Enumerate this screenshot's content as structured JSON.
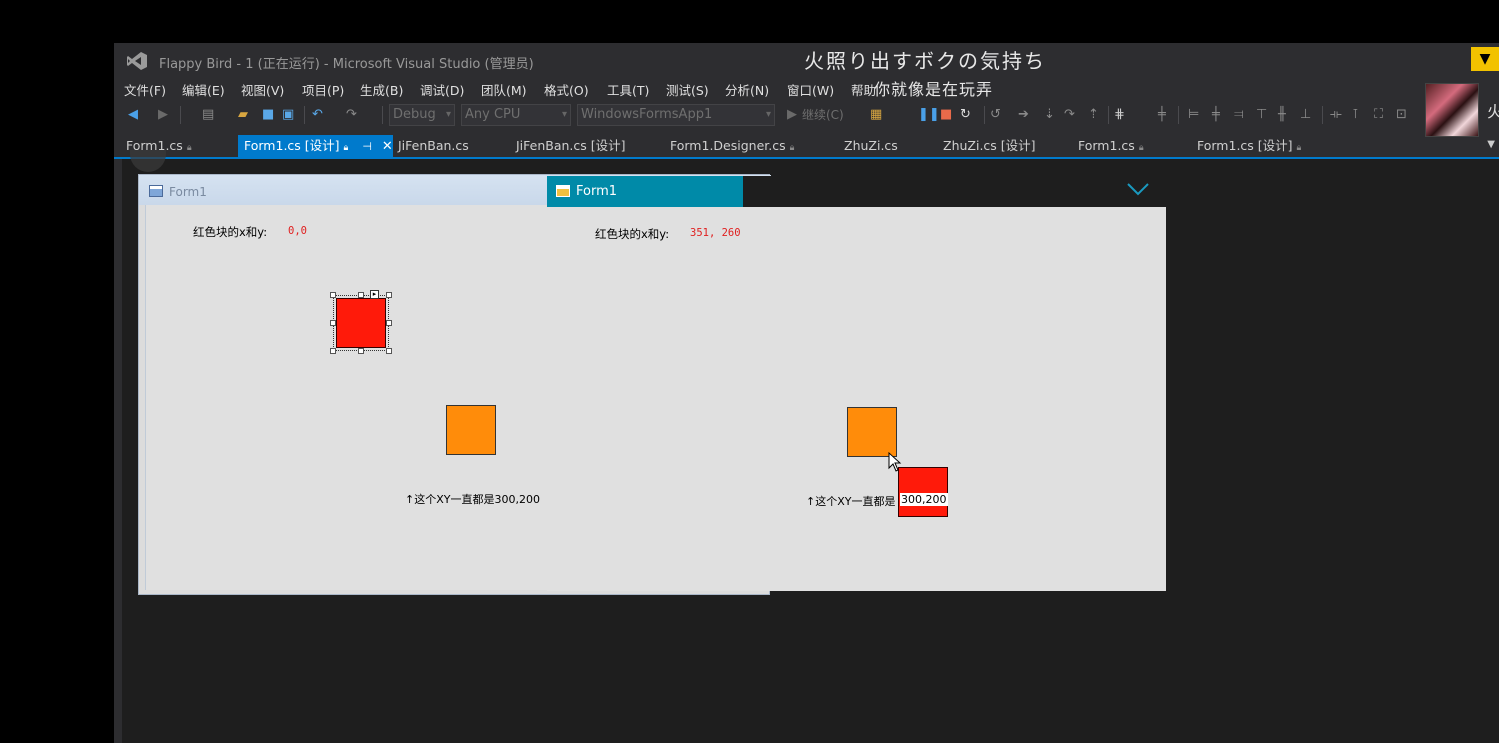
{
  "window": {
    "title": "Flappy Bird - 1 (正在运行) - Microsoft Visual Studio (管理员)"
  },
  "lyrics": {
    "line1": "火照り出すボクの気持ち",
    "line2": "你就像是在玩弄"
  },
  "edge_text": "火",
  "menu": [
    "文件(F)",
    "编辑(E)",
    "视图(V)",
    "项目(P)",
    "生成(B)",
    "调试(D)",
    "团队(M)",
    "格式(O)",
    "工具(T)",
    "测试(S)",
    "分析(N)",
    "窗口(W)",
    "帮助"
  ],
  "toolbar": {
    "config": "Debug",
    "platform": "Any CPU",
    "project": "WindowsFormsApp1",
    "continue_label": "继续(C)"
  },
  "tabs": [
    {
      "label": "Form1.cs",
      "pinned": true,
      "active": false
    },
    {
      "label": "Form1.cs [设计]",
      "pinned": true,
      "active": true
    },
    {
      "label": "JiFenBan.cs",
      "pinned": false,
      "active": false
    },
    {
      "label": "JiFenBan.cs [设计]",
      "pinned": false,
      "active": false
    },
    {
      "label": "Form1.Designer.cs",
      "pinned": true,
      "active": false
    },
    {
      "label": "ZhuZi.cs",
      "pinned": false,
      "active": false
    },
    {
      "label": "ZhuZi.cs [设计]",
      "pinned": false,
      "active": false
    },
    {
      "label": "Form1.cs",
      "pinned": true,
      "active": false
    },
    {
      "label": "Form1.cs [设计]",
      "pinned": true,
      "active": false
    }
  ],
  "designer_form": {
    "title": "Form1",
    "coord_label": "红色块的x和y:",
    "coord_value": "0,0",
    "note": "↑这个XY一直都是300,200"
  },
  "running_form": {
    "title": "Form1",
    "coord_label": "红色块的x和y:",
    "coord_value": "351, 260",
    "note": "↑这个XY一直都是",
    "note_value": "300,200"
  },
  "colors": {
    "vs_background": "#2d2d30",
    "accent": "#007acc",
    "running_title": "#008aa8",
    "red_block": "#ff1a0a",
    "orange_block": "#ff8c0a"
  }
}
